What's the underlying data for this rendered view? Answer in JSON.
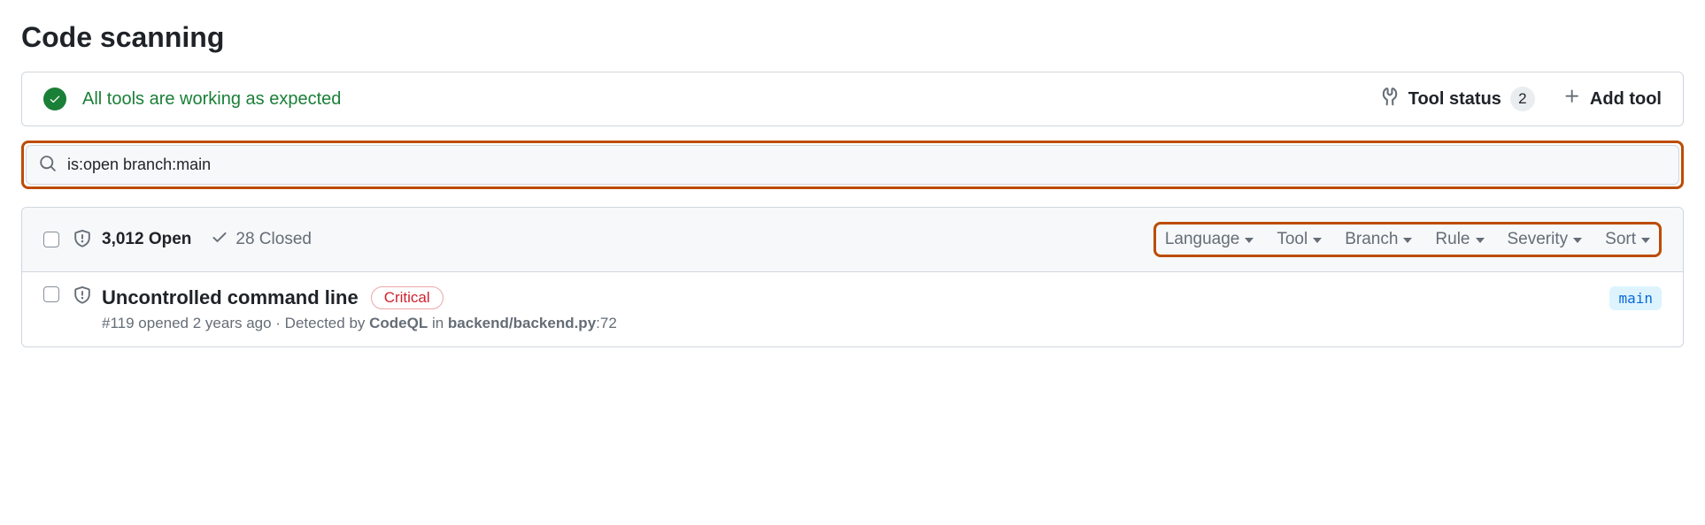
{
  "page_title": "Code scanning",
  "status_bar": {
    "message": "All tools are working as expected",
    "tool_status_label": "Tool status",
    "tool_status_count": "2",
    "add_tool_label": "Add tool"
  },
  "search": {
    "value": "is:open branch:main"
  },
  "list_header": {
    "open_text": "3,012 Open",
    "closed_text": "28 Closed"
  },
  "filters": {
    "language": "Language",
    "tool": "Tool",
    "branch": "Branch",
    "rule": "Rule",
    "severity": "Severity",
    "sort": "Sort"
  },
  "alert": {
    "title": "Uncontrolled command line",
    "severity": "Critical",
    "meta_prefix": "#119 opened 2 years ago · Detected by ",
    "meta_tool": "CodeQL",
    "meta_in": " in ",
    "meta_path": "backend/backend.py",
    "meta_line": ":72",
    "branch": "main"
  }
}
